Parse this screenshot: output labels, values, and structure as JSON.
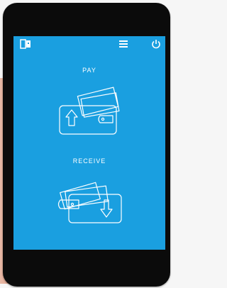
{
  "app": {
    "pay_label": "PAY",
    "receive_label": "RECEIVE"
  },
  "icons": {
    "top_left": "wallet-logo-icon",
    "top_middle": "menu-icon",
    "top_right": "power-icon",
    "pay": "wallet-upload-icon",
    "receive": "wallet-download-icon"
  },
  "colors": {
    "screen_blue": "#1a9fe0",
    "phone_frame": "#0b0b0b",
    "icon_white": "#ffffff"
  }
}
